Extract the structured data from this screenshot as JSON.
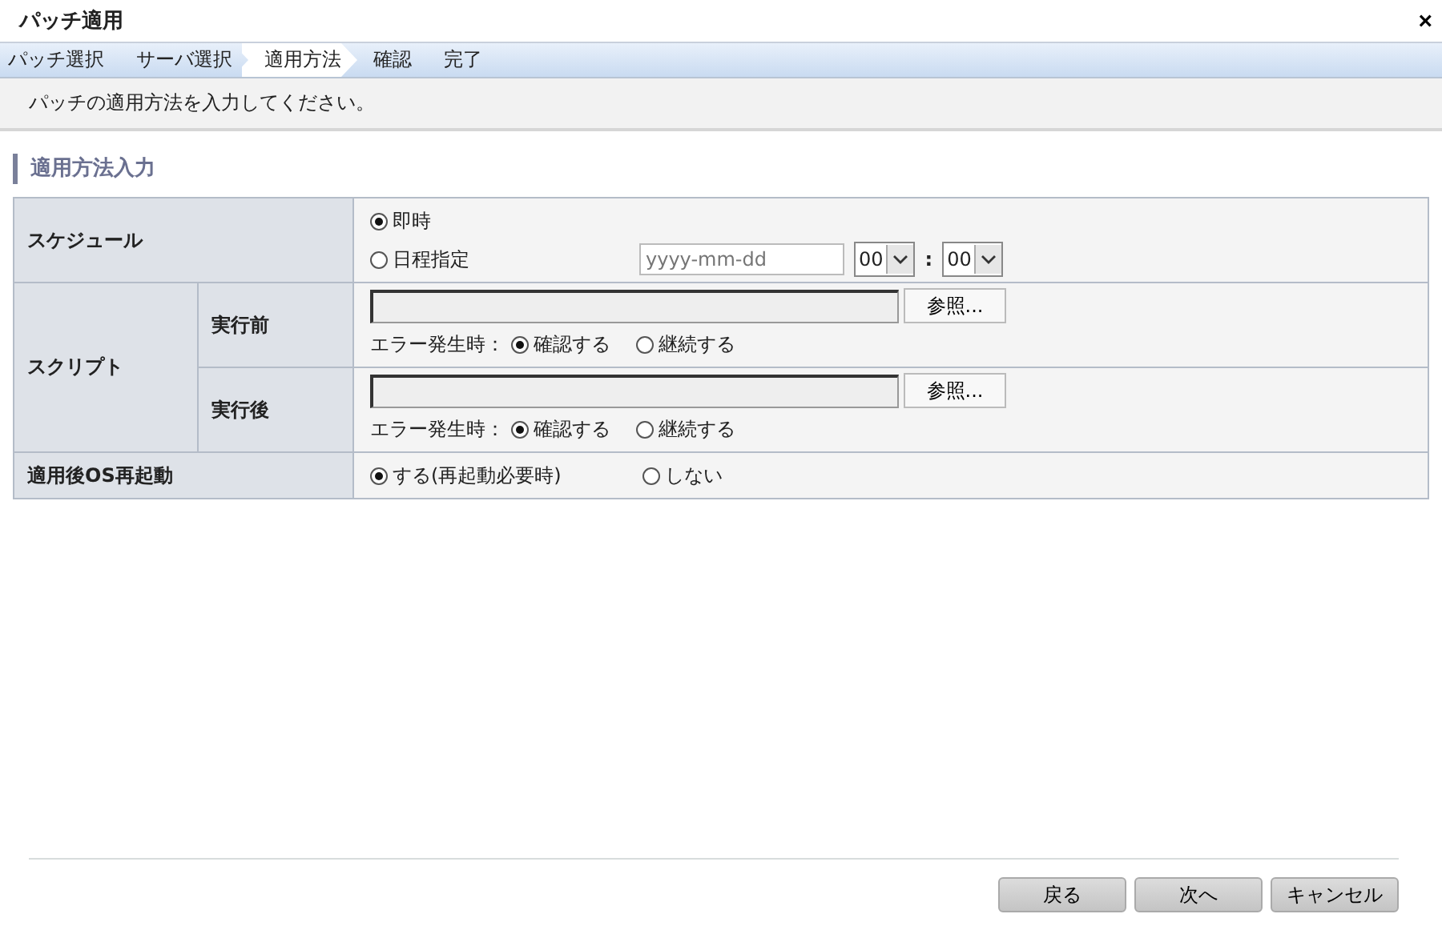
{
  "window": {
    "title": "パッチ適用",
    "close": "×"
  },
  "steps": [
    {
      "label": "パッチ選択",
      "selected": false
    },
    {
      "label": "サーバ選択",
      "selected": false
    },
    {
      "label": "適用方法",
      "selected": true
    },
    {
      "label": "確認",
      "selected": false
    },
    {
      "label": "完了",
      "selected": false
    }
  ],
  "message": "パッチの適用方法を入力してください。",
  "section_title": "適用方法入力",
  "schedule": {
    "label": "スケジュール",
    "options": [
      {
        "label": "即時",
        "selected": true
      },
      {
        "label": "日程指定",
        "selected": false
      }
    ],
    "date": {
      "placeholder": "yyyy-mm-dd"
    },
    "hour": "00",
    "separator": ":",
    "minute": "00"
  },
  "script": {
    "label": "スクリプト",
    "rows": [
      {
        "label": "実行前",
        "browse": "参照...",
        "error_label": "エラー発生時：",
        "options": [
          {
            "label": "確認する",
            "selected": true
          },
          {
            "label": "継続する",
            "selected": false
          }
        ]
      },
      {
        "label": "実行後",
        "browse": "参照...",
        "error_label": "エラー発生時：",
        "options": [
          {
            "label": "確認する",
            "selected": true
          },
          {
            "label": "継続する",
            "selected": false
          }
        ]
      }
    ]
  },
  "reboot": {
    "label": "適用後OS再起動",
    "options": [
      {
        "label": "する(再起動必要時)",
        "selected": true
      },
      {
        "label": "しない",
        "selected": false
      }
    ]
  },
  "buttons": [
    "戻る",
    "次へ",
    "キャンセル"
  ]
}
